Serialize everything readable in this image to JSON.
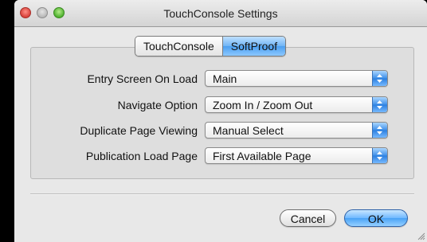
{
  "window": {
    "title": "TouchConsole Settings"
  },
  "tabs": [
    {
      "label": "TouchConsole",
      "selected": false
    },
    {
      "label": "SoftProof",
      "selected": true
    }
  ],
  "settings": [
    {
      "label": "Entry Screen On Load",
      "value": "Main"
    },
    {
      "label": "Navigate Option",
      "value": "Zoom In / Zoom Out"
    },
    {
      "label": "Duplicate Page Viewing",
      "value": "Manual Select"
    },
    {
      "label": "Publication Load Page",
      "value": "First Available Page"
    }
  ],
  "buttons": {
    "cancel_label": "Cancel",
    "ok_label": "OK"
  },
  "colors": {
    "accent": "#4aa2f6",
    "close": "#d7413a",
    "zoom": "#4fb12f"
  }
}
